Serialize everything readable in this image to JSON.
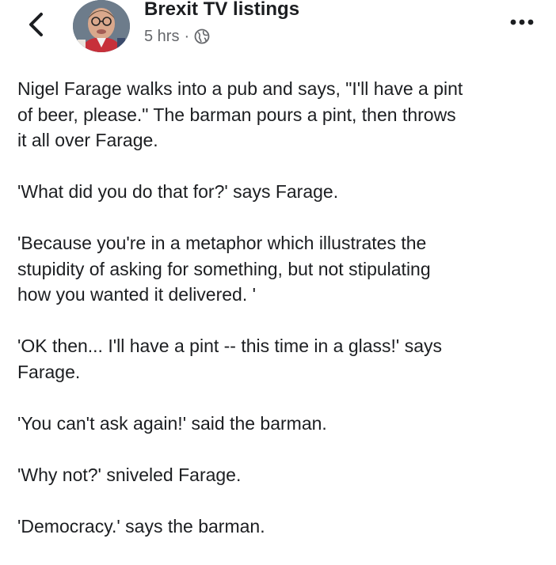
{
  "post": {
    "author": "Brexit TV listings",
    "time": "5 hrs",
    "separator": "·",
    "privacy_icon": "globe-icon",
    "back_icon": "chevron-left-icon",
    "more_icon": "more-dots-icon",
    "paragraphs": [
      "Nigel Farage walks into a pub and says, \"I'll have a pint\nof beer, please.\" The barman pours a pint, then throws\nit all over Farage.",
      "'What did you do that for?' says Farage.",
      "'Because you're in a metaphor which illustrates the\nstupidity of asking for something, but not stipulating\nhow you wanted it delivered. '",
      "'OK then... I'll have a pint -- this time in a glass!' says\nFarage.",
      "'You can't ask again!' said the barman.",
      "'Why not?' sniveled Farage.",
      "'Democracy.' says the barman."
    ]
  },
  "colors": {
    "text": "#1c1e21",
    "meta": "#65676b",
    "background": "#ffffff"
  }
}
